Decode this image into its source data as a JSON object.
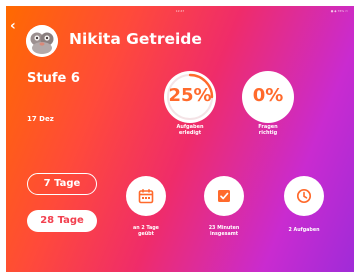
{
  "status_bar": {
    "time": "12:47",
    "right": "● ◆ 76% ▭"
  },
  "header": {
    "back_label": "‹",
    "user_name": "Nikita Getreide"
  },
  "profile": {
    "level": "Stufe 6",
    "date": "17 Dez"
  },
  "stats": [
    {
      "value": "25%",
      "progress": 0.25,
      "label_line1": "Aufgaben",
      "label_line2": "erledigt"
    },
    {
      "value": "0%",
      "progress": 0,
      "label_line1": "Fragen",
      "label_line2": "richtig"
    }
  ],
  "range_buttons": [
    {
      "label": "7 Tage",
      "selected": false
    },
    {
      "label": "28 Tage",
      "selected": true
    }
  ],
  "metrics": [
    {
      "icon": "calendar-icon",
      "label_line1": "an 2 Tage",
      "label_line2": "geübt"
    },
    {
      "icon": "checklist-icon",
      "label_line1": "23 Minuten",
      "label_line2": "insgesamt"
    },
    {
      "icon": "clock-icon",
      "label_line1": "2 Aufgaben",
      "label_line2": ""
    }
  ],
  "colors": {
    "accent": "#ff6a2c",
    "pill_text": "#f2404f",
    "gradient_start": "#ff6a00",
    "gradient_end": "#a02bd8"
  }
}
